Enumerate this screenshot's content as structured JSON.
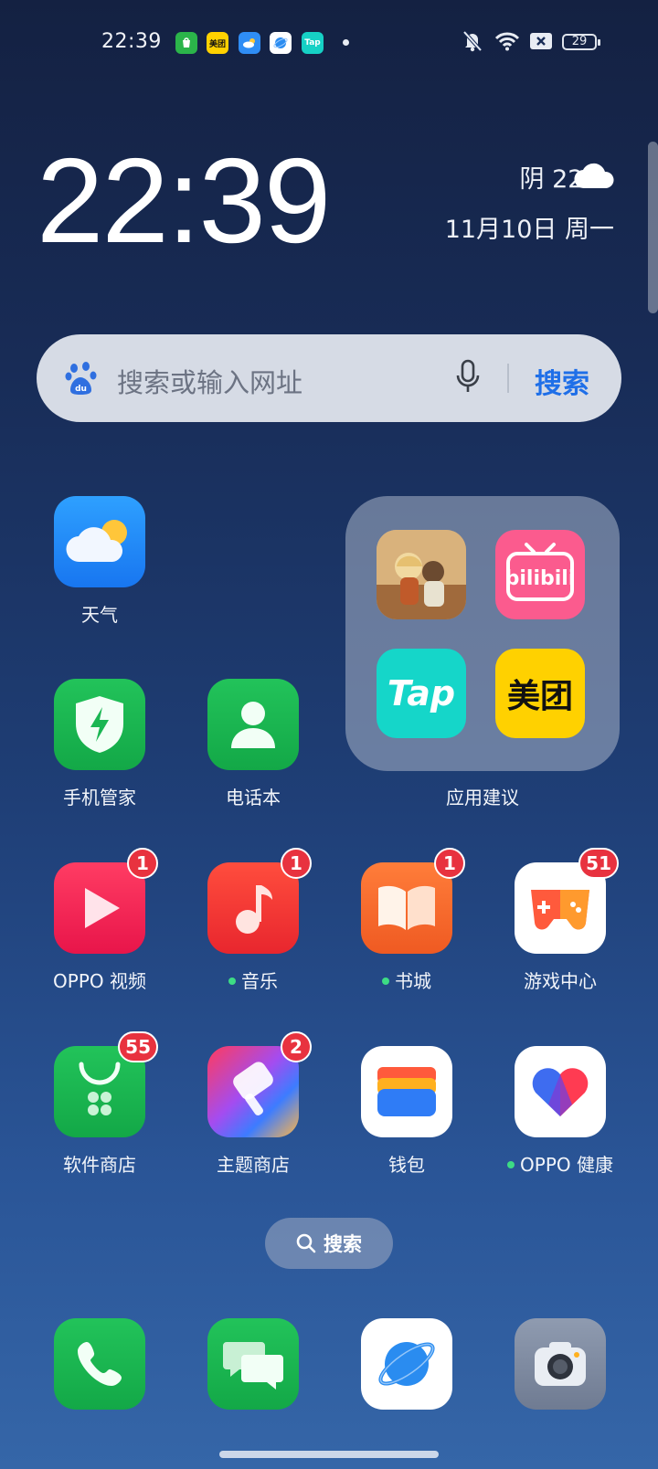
{
  "status_bar": {
    "time": "22:39",
    "notification_icons": [
      "app-market-icon",
      "meituan-icon",
      "weather-icon",
      "browser-icon",
      "taptap-icon"
    ],
    "notif_meituan_text": "美团",
    "notif_tap_text": "Tap",
    "battery": "29",
    "icons": [
      "mute-icon",
      "wifi-icon",
      "no-sim-icon",
      "battery-icon"
    ]
  },
  "clock_widget": {
    "time": "22:39",
    "weather": "阴 22°",
    "date": "11月10日  周一"
  },
  "search_bar": {
    "placeholder": "搜索或输入网址",
    "button": "搜索"
  },
  "apps": {
    "weather": {
      "label": "天气"
    },
    "phone_manager": {
      "label": "手机管家"
    },
    "contacts": {
      "label": "电话本"
    },
    "oppo_video": {
      "label": "OPPO 视频",
      "badge": "1"
    },
    "music": {
      "label": "音乐",
      "badge": "1"
    },
    "book_store": {
      "label": "书城",
      "badge": "1"
    },
    "game_center": {
      "label": "游戏中心",
      "badge": "51"
    },
    "app_store": {
      "label": "软件商店",
      "badge": "55"
    },
    "theme_store": {
      "label": "主题商店",
      "badge": "2"
    },
    "wallet": {
      "label": "钱包"
    },
    "oppo_health": {
      "label": "OPPO 健康"
    }
  },
  "folder": {
    "label": "应用建议",
    "items": {
      "bilibili": "bilibili",
      "taptap": "Tap",
      "meituan": "美团"
    }
  },
  "page_search_pill": {
    "label": "搜索"
  },
  "dock": [
    "phone-icon",
    "messages-icon",
    "browser-icon",
    "camera-icon"
  ],
  "colors": {
    "badge": "#e8323f",
    "search_accent": "#1f6fe8"
  }
}
